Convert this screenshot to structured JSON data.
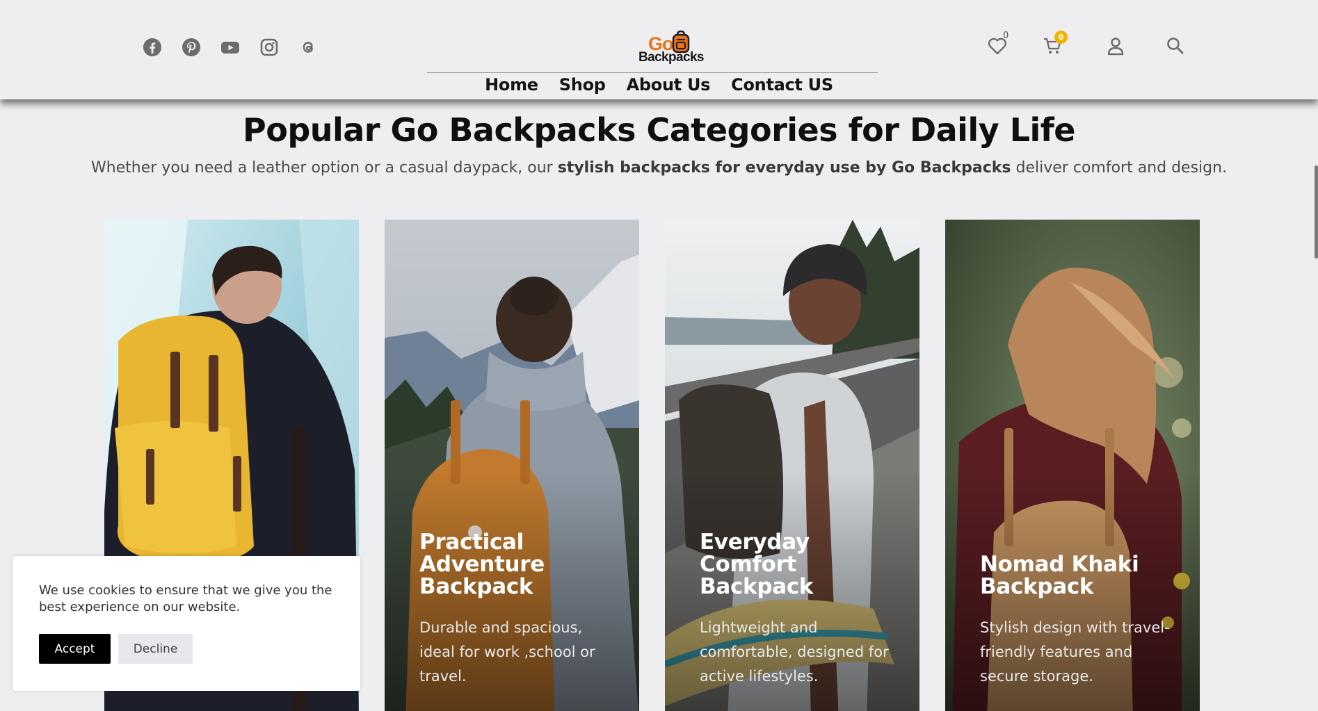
{
  "header": {
    "social_icons": [
      "facebook-icon",
      "pinterest-icon",
      "youtube-icon",
      "instagram-icon",
      "threads-icon"
    ],
    "logo": {
      "line1": "Go",
      "line2": "Backpacks"
    },
    "nav": [
      "Home",
      "Shop",
      "About Us",
      "Contact US"
    ],
    "wishlist_count": "0",
    "cart_count": "0",
    "right_icons": [
      "heart-icon",
      "cart-icon",
      "user-icon",
      "search-icon"
    ]
  },
  "main": {
    "title": "Popular Go Backpacks Categories for Daily Life",
    "subtitle_pre": "Whether you need a leather option or a casual daypack, our ",
    "subtitle_bold": "stylish backpacks for everyday use by Go Backpacks",
    "subtitle_post": " deliver comfort and design.",
    "cards": [
      {
        "title": "",
        "description": ""
      },
      {
        "title": "Practical Adventure Backpack",
        "description": "Durable and spacious, ideal for work ,school or travel."
      },
      {
        "title": "Everyday Comfort Backpack",
        "description": "Lightweight and comfortable, designed for active lifestyles."
      },
      {
        "title": "Nomad Khaki Backpack",
        "description": "Stylish design with travel-friendly features and secure storage."
      }
    ]
  },
  "cookie": {
    "message": "We use cookies to ensure that we give you the best experience on our website.",
    "accept_label": "Accept",
    "decline_label": "Decline"
  },
  "colors": {
    "brand_orange": "#e8731a",
    "badge_yellow": "#f0b400",
    "page_bg": "#eeeef0"
  }
}
